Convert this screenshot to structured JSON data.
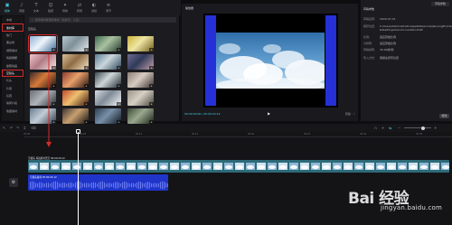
{
  "topbar": {
    "tools": [
      {
        "label": "媒体",
        "icon": "media-icon",
        "active": true
      },
      {
        "label": "音频",
        "icon": "audio-icon"
      },
      {
        "label": "文本",
        "icon": "text-icon"
      },
      {
        "label": "贴纸",
        "icon": "sticker-icon"
      },
      {
        "label": "特效",
        "icon": "effects-icon"
      },
      {
        "label": "转场",
        "icon": "transition-icon"
      },
      {
        "label": "滤镜",
        "icon": "filter-icon"
      },
      {
        "label": "调节",
        "icon": "adjust-icon"
      }
    ]
  },
  "sidebar": {
    "items": [
      {
        "label": "本地"
      },
      {
        "label": "素材库",
        "boxed": true
      },
      {
        "label": "热门"
      },
      {
        "label": "黑白场"
      },
      {
        "label": "绿幕素材"
      },
      {
        "label": "情绪爆梗"
      },
      {
        "label": "故障动画"
      },
      {
        "label": "空镜头",
        "boxed": true
      },
      {
        "label": "片头"
      },
      {
        "label": "片尾"
      },
      {
        "label": "氛围"
      },
      {
        "label": "搞笑片段"
      },
      {
        "label": "收藏素材"
      }
    ]
  },
  "browser": {
    "search_placeholder": "搜索素材库里的素材（如春天、人生）",
    "section_title": "空镜头",
    "thumbnails": [
      {
        "colors": [
          "#8fb3d9",
          "#eef4fa",
          "#3d6a9a"
        ],
        "selected": true
      },
      {
        "colors": [
          "#b6c7cf",
          "#7e9098",
          "#e5ecee"
        ]
      },
      {
        "colors": [
          "#3c6a4e",
          "#a9c1a0",
          "#25382c"
        ]
      },
      {
        "colors": [
          "#c9b23a",
          "#f0e6a4",
          "#6e5c1a"
        ]
      },
      {
        "colors": [
          "#f1c6c8",
          "#b07b86",
          "#f7e6e2"
        ]
      },
      {
        "colors": [
          "#d9bf96",
          "#8f6c44",
          "#f4e4c6"
        ]
      },
      {
        "colors": [
          "#5c7e94",
          "#cad6dc",
          "#2e4758"
        ]
      },
      {
        "colors": [
          "#6e6a90",
          "#2f3a5a",
          "#c3a1a6"
        ]
      },
      {
        "colors": [
          "#3a2a2a",
          "#d87a3a",
          "#1a1212"
        ]
      },
      {
        "colors": [
          "#8a3a2e",
          "#e8a06a",
          "#2a1410"
        ]
      },
      {
        "colors": [
          "#3a4a52",
          "#cfd6d8",
          "#1e2a30"
        ]
      },
      {
        "colors": [
          "#8a7e78",
          "#d7cbc2",
          "#3b3230"
        ]
      },
      {
        "colors": [
          "#6a6e74",
          "#aeb4ba",
          "#2c3034"
        ]
      },
      {
        "colors": [
          "#c04a2e",
          "#f0c070",
          "#3a1810"
        ]
      },
      {
        "colors": [
          "#d8dde2",
          "#7e8a96",
          "#f4f6f8"
        ]
      },
      {
        "colors": [
          "#9a9488",
          "#d6d0c4",
          "#4a463e"
        ]
      },
      {
        "colors": [
          "#6a7e92",
          "#c2ccd6",
          "#2e3a48"
        ]
      },
      {
        "colors": [
          "#3a3232",
          "#c8a070",
          "#141010"
        ]
      },
      {
        "colors": [
          "#2e3e50",
          "#7890a8",
          "#101820"
        ]
      },
      {
        "colors": [
          "#3a4a38",
          "#9aa88e",
          "#1a2218"
        ]
      }
    ]
  },
  "player": {
    "title": "播放器",
    "timecode": "00:00:00:00 / 00:00:24:12",
    "tools": [
      "原始",
      "⛶"
    ],
    "colors": {
      "edge": "#2530d6",
      "sky": "#3f7fb8"
    }
  },
  "props": {
    "title": "草稿参数",
    "badge": "草稿参数",
    "rows": [
      {
        "k": "草稿名称：",
        "v": "2020-07-01"
      },
      {
        "k": "保存位置：",
        "v": "C:/Users/Administrator/AppData/Local/JianyingPro/User Data/Projects/com.lveditor.draft"
      },
      {
        "k": "比例：",
        "v": "适应原始比例"
      },
      {
        "k": "分辨率：",
        "v": "适应原始比例"
      },
      {
        "k": "草稿帧率：",
        "v": "30.00帧/秒"
      },
      {
        "k": "导入方式：",
        "v": "保留在原有位置"
      }
    ],
    "button": "修改"
  },
  "timeline": {
    "ticks": [
      "00:00",
      "00:05",
      "00:10",
      "00:15",
      "00:20",
      "00:25",
      "00:30",
      "00:35"
    ],
    "video_clip": {
      "label": "空镜头  海边延时天空  00:00:20:12",
      "color": "#2d6a78"
    },
    "audio_clip": {
      "label": "空镜头素材  00:00:24:12",
      "color": "#1f35c9"
    }
  },
  "annotation": {
    "color": "#d62a2a"
  },
  "watermark": {
    "main": "Bai 经验",
    "sub": "jingyan.baidu.com"
  }
}
